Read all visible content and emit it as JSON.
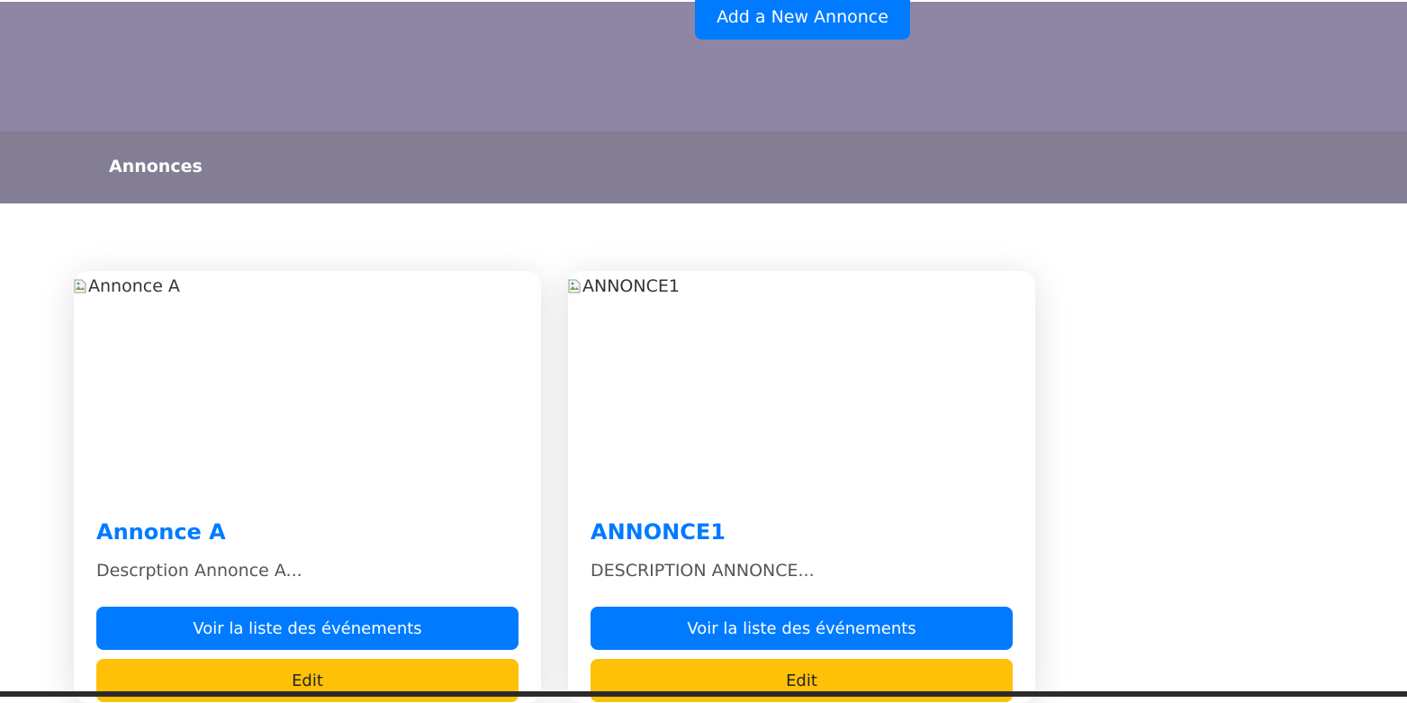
{
  "header": {
    "add_button_label": "Add a New Annonce",
    "section_title": "Annonces"
  },
  "cards": [
    {
      "image_alt": "Annonce A",
      "title": "Annonce A",
      "description": "Descrption Annonce A...",
      "list_button_label": "Voir la liste des événements",
      "edit_button_label": "Edit"
    },
    {
      "image_alt": "ANNONCE1",
      "title": "ANNONCE1",
      "description": "DESCRIPTION ANNONCE...",
      "list_button_label": "Voir la liste des événements",
      "edit_button_label": "Edit"
    }
  ],
  "icons": {
    "broken_image": "broken-image-icon"
  },
  "colors": {
    "hero": "#8e86a4",
    "subbar": "#847e95",
    "primary": "#007bff",
    "warning": "#ffc107"
  }
}
